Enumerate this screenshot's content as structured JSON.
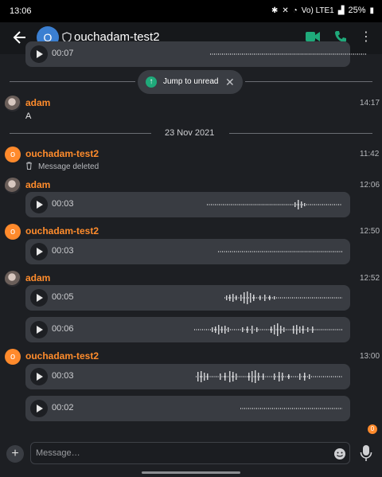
{
  "status_bar": {
    "time": "13:06",
    "signal": "Vo) LTE1",
    "battery": "25%"
  },
  "header": {
    "room_avatar_letter": "O",
    "room_name": "ouchadam-test2"
  },
  "timeline": {
    "top_partial_voice": {
      "duration": "00:07"
    },
    "jump_to_unread": {
      "label": "Jump to unread"
    },
    "msg_adam_text": {
      "sender": "adam",
      "time": "14:17",
      "body": "A"
    },
    "date_divider": "23 Nov 2021",
    "msg_deleted": {
      "sender": "ouchadam-test2",
      "avatar_letter": "o",
      "time": "11:42",
      "body": "Message deleted"
    },
    "voice_group_1": {
      "sender": "adam",
      "time": "12:06",
      "items": [
        {
          "duration": "00:03"
        }
      ]
    },
    "voice_group_2": {
      "sender": "ouchadam-test2",
      "avatar_letter": "o",
      "time": "12:50",
      "items": [
        {
          "duration": "00:03"
        }
      ]
    },
    "voice_group_3": {
      "sender": "adam",
      "time": "12:52",
      "items": [
        {
          "duration": "00:05"
        },
        {
          "duration": "00:06"
        }
      ]
    },
    "voice_group_4": {
      "sender": "ouchadam-test2",
      "avatar_letter": "o",
      "time": "13:00",
      "items": [
        {
          "duration": "00:03"
        },
        {
          "duration": "00:02"
        }
      ]
    }
  },
  "new_messages_badge": "0",
  "composer": {
    "placeholder": "Message…"
  },
  "colors": {
    "accent_orange": "#ff8c2c",
    "call_green": "#1fa97a",
    "background": "#1d1f23",
    "bubble": "#393c42"
  }
}
